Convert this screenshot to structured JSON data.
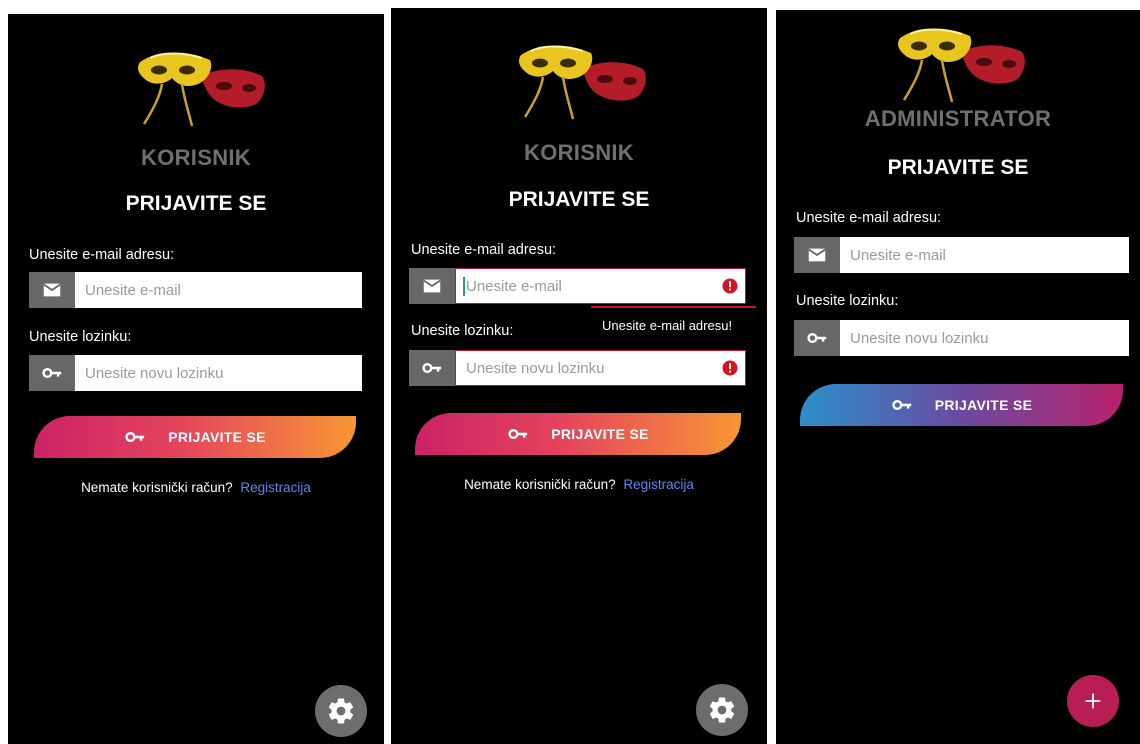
{
  "screens": [
    {
      "role_title": "KORISNIK",
      "login_title": "PRIJAVITE SE",
      "email_label": "Unesite e-mail adresu:",
      "email_placeholder": "Unesite e-mail",
      "password_label": "Unesite lozinku:",
      "password_placeholder": "Unesite novu lozinku",
      "login_button": "PRIJAVITE SE",
      "no_account_text": "Nemate korisnički račun?",
      "register_link": "Registracija",
      "fab_icon": "gear-icon"
    },
    {
      "role_title": "KORISNIK",
      "login_title": "PRIJAVITE SE",
      "email_label": "Unesite e-mail adresu:",
      "email_placeholder": "Unesite e-mail",
      "email_error": "Unesite e-mail adresu!",
      "password_label": "Unesite lozinku:",
      "password_placeholder": "Unesite novu lozinku",
      "login_button": "PRIJAVITE SE",
      "no_account_text": "Nemate korisnički račun?",
      "register_link": "Registracija",
      "fab_icon": "gear-icon"
    },
    {
      "role_title": "ADMINISTRATOR",
      "login_title": "PRIJAVITE SE",
      "email_label": "Unesite e-mail adresu:",
      "email_placeholder": "Unesite e-mail",
      "password_label": "Unesite lozinku:",
      "password_placeholder": "Unesite novu lozinku",
      "login_button": "PRIJAVITE SE",
      "fab_icon": "plus-icon"
    }
  ],
  "colors": {
    "background": "#000000",
    "title_gray": "#6f6f6f",
    "icon_box_gray": "#676767",
    "link_blue": "#5a88ee",
    "error_red": "#c0152a",
    "fab_red": "#b81e55",
    "warm_gradient": [
      "#cc2267",
      "#f79635"
    ],
    "cool_gradient": [
      "#2c8fcb",
      "#b8226a"
    ]
  }
}
